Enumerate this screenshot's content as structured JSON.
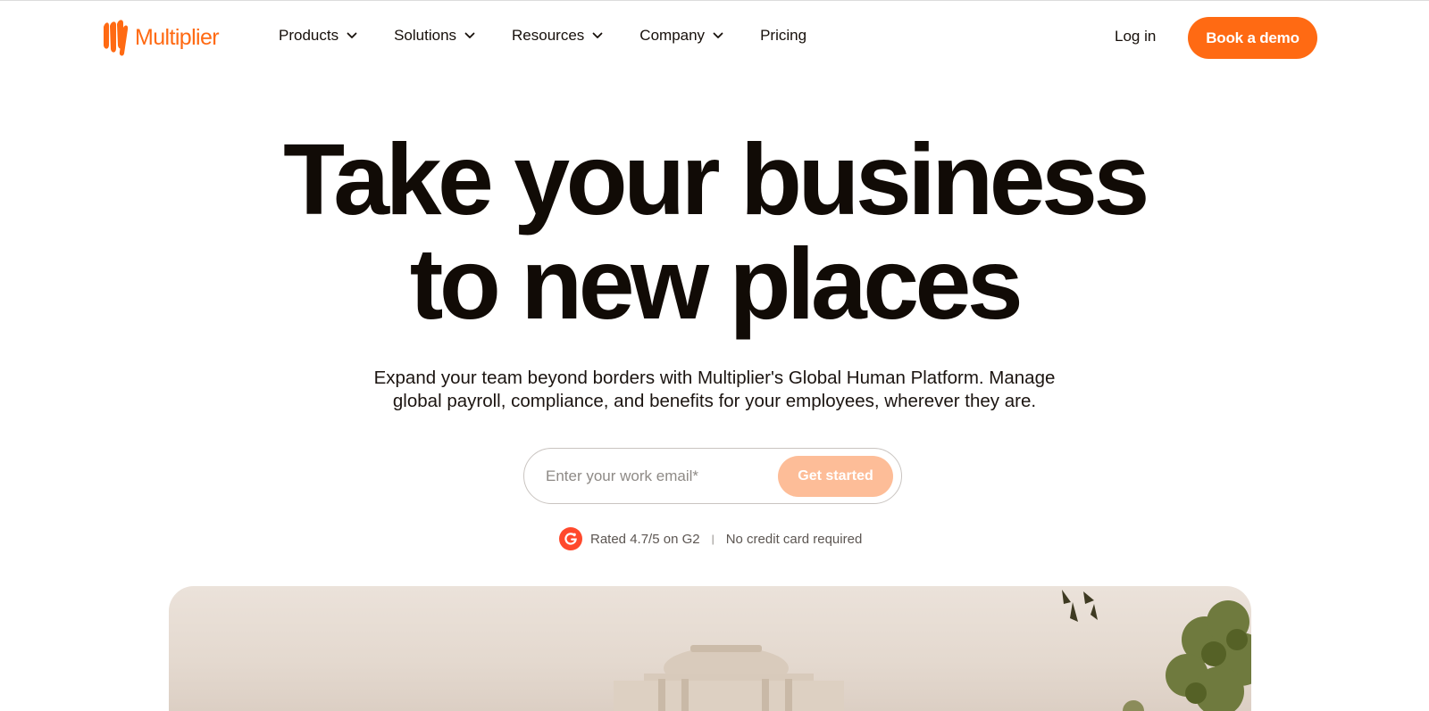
{
  "brand": {
    "name": "Multiplier",
    "accent": "#ff6a13"
  },
  "nav": {
    "items": [
      {
        "label": "Products",
        "has_dropdown": true
      },
      {
        "label": "Solutions",
        "has_dropdown": true
      },
      {
        "label": "Resources",
        "has_dropdown": true
      },
      {
        "label": "Company",
        "has_dropdown": true
      },
      {
        "label": "Pricing",
        "has_dropdown": false
      }
    ],
    "login_label": "Log in",
    "demo_label": "Book a demo"
  },
  "hero": {
    "title_line1": "Take your business",
    "title_line2": "to new places",
    "subtitle_line1": "Expand your team beyond borders with Multiplier's Global Human Platform. Manage",
    "subtitle_line2": "global payroll, compliance, and benefits for your employees, wherever they are.",
    "email_placeholder": "Enter your work email*",
    "email_value": "",
    "cta_label": "Get started",
    "cta_color": "#fdbd98"
  },
  "trust": {
    "badge_icon": "g2-logo-icon",
    "rating_text": "Rated 4.7/5 on G2",
    "separator": "|",
    "no_card_text": "No credit card required"
  }
}
